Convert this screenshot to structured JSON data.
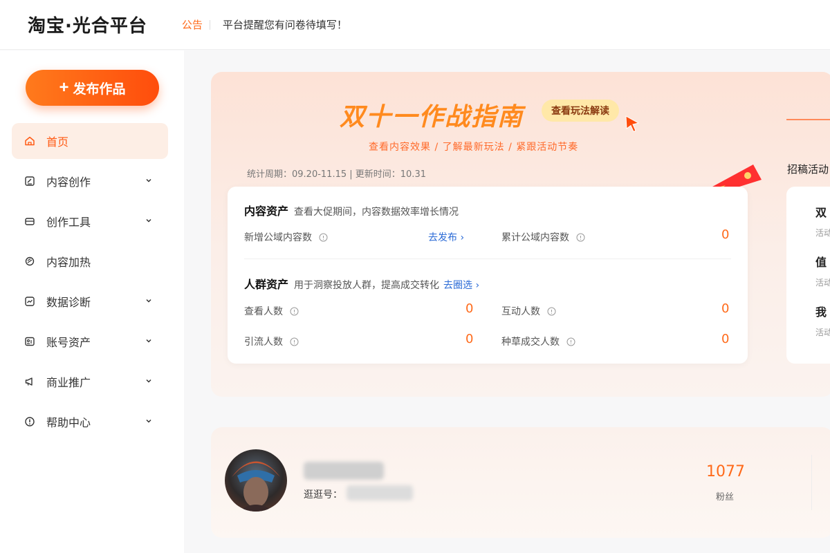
{
  "header": {
    "logo": "淘宝·光合平台",
    "notice_label": "公告",
    "notice_text": "平台提醒您有问卷待填写！"
  },
  "sidebar": {
    "publish_label": "发布作品",
    "items": [
      {
        "label": "首页",
        "icon": "home-icon",
        "active": true
      },
      {
        "label": "内容创作",
        "icon": "edit-icon"
      },
      {
        "label": "创作工具",
        "icon": "toolbox-icon"
      },
      {
        "label": "内容加热",
        "icon": "flame-icon"
      },
      {
        "label": "数据诊断",
        "icon": "chart-icon"
      },
      {
        "label": "账号资产",
        "icon": "id-card-icon"
      },
      {
        "label": "商业推广",
        "icon": "megaphone-icon"
      },
      {
        "label": "帮助中心",
        "icon": "help-icon"
      }
    ]
  },
  "banner": {
    "title": "双十一作战指南",
    "link_label": "查看玩法解读",
    "subtitle": "查看内容效果 / 了解最新玩法 / 紧跟活动节奏",
    "stat_period": "统计周期：09.20-11.15 | 更新时间：10.31",
    "content_assets": {
      "title": "内容资产",
      "desc": "查看大促期间，内容数据效率增长情况",
      "new_label": "新增公域内容数",
      "go_publish": "去发布 ›",
      "total_label": "累计公域内容数",
      "total_value": "0"
    },
    "crowd_assets": {
      "title": "人群资产",
      "desc": "用于洞察投放人群，提高成交转化",
      "link": "去圈选 ›",
      "view_label": "查看人数",
      "view_value": "0",
      "interact_label": "互动人数",
      "interact_value": "0",
      "traffic_label": "引流人数",
      "traffic_value": "0",
      "deal_label": "种草成交人数",
      "deal_value": "0"
    },
    "right_title": "招稿活动",
    "right_items": [
      {
        "title": "双",
        "sub": "活动"
      },
      {
        "title": "值",
        "sub": "活动"
      },
      {
        "title": "我",
        "sub": "活动"
      }
    ]
  },
  "profile": {
    "id_label": "逛逛号：",
    "fans_value": "1077",
    "fans_label": "粉丝"
  },
  "colors": {
    "accent": "#ff5a14",
    "link": "#2a6ad6",
    "banner_title": "#ff8a1e"
  }
}
